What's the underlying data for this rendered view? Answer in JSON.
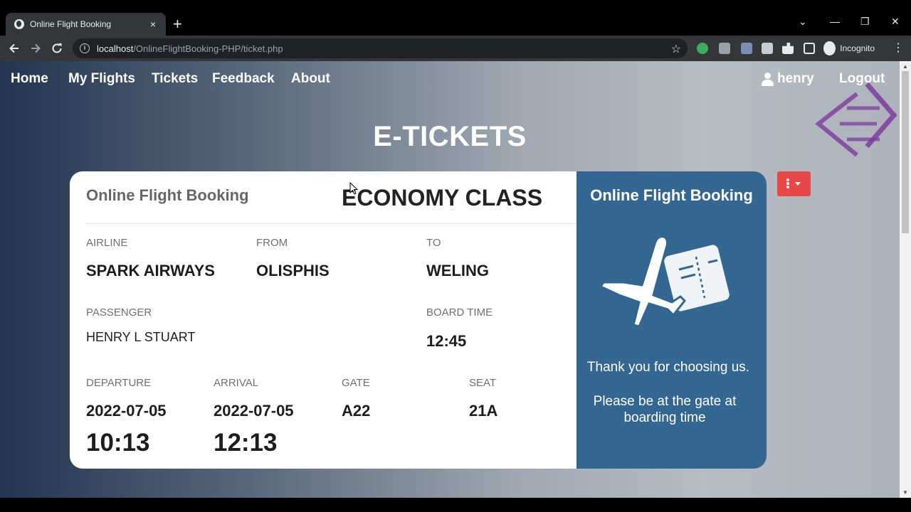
{
  "browser": {
    "tab_title": "Online Flight Booking",
    "tab_close": "×",
    "new_tab": "+",
    "url_host": "localhost",
    "url_path": "/OnlineFlightBooking-PHP/ticket.php",
    "profile_label": "Incognito",
    "win_minimize": "—",
    "win_restore": "❐",
    "win_close": "✕",
    "tab_search": "⌄"
  },
  "nav": {
    "home": "Home",
    "my_flights": "My Flights",
    "tickets": "Tickets",
    "feedback": "Feedback",
    "about": "About",
    "username": "henry",
    "logout": "Logout"
  },
  "page": {
    "title": "E-TICKETS"
  },
  "ticket": {
    "brand": "Online Flight Booking",
    "class": "ECONOMY CLASS",
    "labels": {
      "airline": "AIRLINE",
      "from": "FROM",
      "to": "TO",
      "passenger": "PASSENGER",
      "board_time": "BOARD TIME",
      "departure": "DEPARTURE",
      "arrival": "ARRIVAL",
      "gate": "GATE",
      "seat": "SEAT"
    },
    "airline": "SPARK AIRWAYS",
    "from": "OLISPHIS",
    "to": "WELING",
    "passenger": "HENRY L STUART",
    "board_time": "12:45",
    "departure_date": "2022-07-05",
    "departure_time": "10:13",
    "arrival_date": "2022-07-05",
    "arrival_time": "12:13",
    "gate": "A22",
    "seat": "21A"
  },
  "stub": {
    "brand": "Online Flight Booking",
    "thanks": "Thank you for choosing us.",
    "note": "Please be at the gate at boarding time"
  },
  "colors": {
    "stub_bg": "#336791",
    "action_button": "#e94848"
  }
}
